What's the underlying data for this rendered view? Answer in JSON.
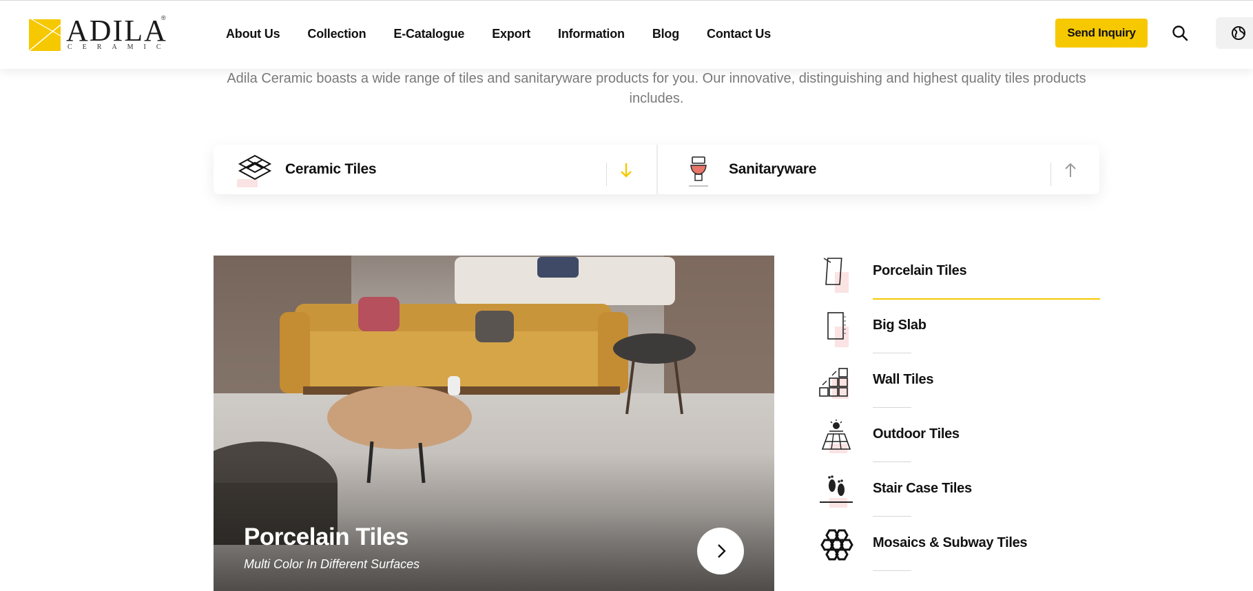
{
  "brand": {
    "name": "ADILA",
    "tagline": "CERAMIC",
    "reg_mark": "®",
    "accent_color": "#f6c800"
  },
  "nav": {
    "items": [
      "About Us",
      "Collection",
      "E-Catalogue",
      "Export",
      "Information",
      "Blog",
      "Contact Us"
    ]
  },
  "header": {
    "send_inquiry": "Send Inquiry",
    "search_icon": "search-icon",
    "language_icon": "globe-icon"
  },
  "intro": {
    "text": "Adila Ceramic boasts a wide range of tiles and sanitaryware products for you. Our innovative, distinguishing and highest quality tiles products includes."
  },
  "categories": [
    {
      "label": "Ceramic Tiles",
      "icon": "tiles-diamond-icon",
      "arrow": "arrow-down-icon",
      "arrow_color": "#f6c800"
    },
    {
      "label": "Sanitaryware",
      "icon": "toilet-icon",
      "arrow": "arrow-up-icon",
      "arrow_color": "#9a9a9a"
    }
  ],
  "hero": {
    "title": "Porcelain Tiles",
    "subtitle": "Multi Color In Different Surfaces",
    "next_icon": "chevron-right-icon"
  },
  "tile_types": [
    {
      "label": "Porcelain Tiles",
      "icon": "porcelain-tile-icon",
      "active": true
    },
    {
      "label": "Big Slab",
      "icon": "big-slab-icon",
      "active": false
    },
    {
      "label": "Wall Tiles",
      "icon": "wall-tiles-icon",
      "active": false
    },
    {
      "label": "Outdoor Tiles",
      "icon": "outdoor-tiles-icon",
      "active": false
    },
    {
      "label": "Stair Case Tiles",
      "icon": "stair-case-icon",
      "active": false
    },
    {
      "label": "Mosaics & Subway Tiles",
      "icon": "mosaic-hexagon-icon",
      "active": false
    }
  ]
}
